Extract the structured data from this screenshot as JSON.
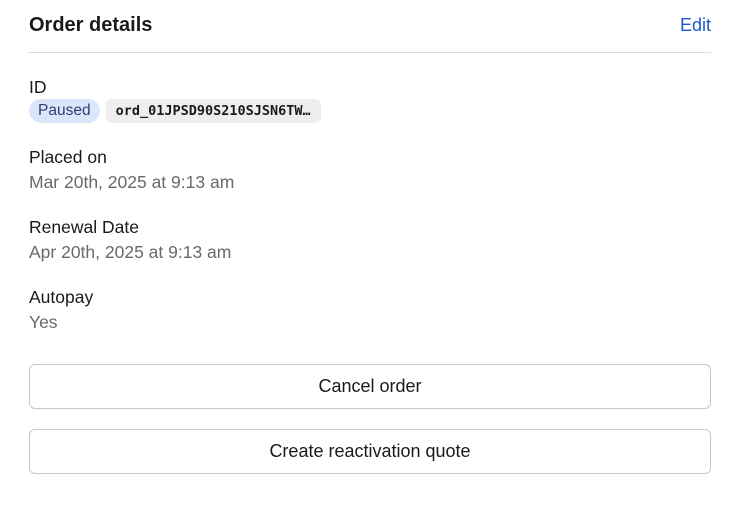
{
  "header": {
    "title": "Order details",
    "edit_label": "Edit"
  },
  "fields": {
    "id": {
      "label": "ID",
      "status": "Paused",
      "value": "ord_01JPSD90S210SJSN6TW…"
    },
    "placed_on": {
      "label": "Placed on",
      "value": "Mar 20th, 2025 at 9:13 am"
    },
    "renewal_date": {
      "label": "Renewal Date",
      "value": "Apr 20th, 2025 at 9:13 am"
    },
    "autopay": {
      "label": "Autopay",
      "value": "Yes"
    }
  },
  "actions": {
    "cancel_label": "Cancel order",
    "reactivation_label": "Create reactivation quote"
  },
  "colors": {
    "link": "#1d56c9",
    "badge_bg": "#dbe6fb",
    "badge_text": "#2b3f73",
    "chip_bg": "#eeeef0",
    "muted_text": "#666b70"
  }
}
